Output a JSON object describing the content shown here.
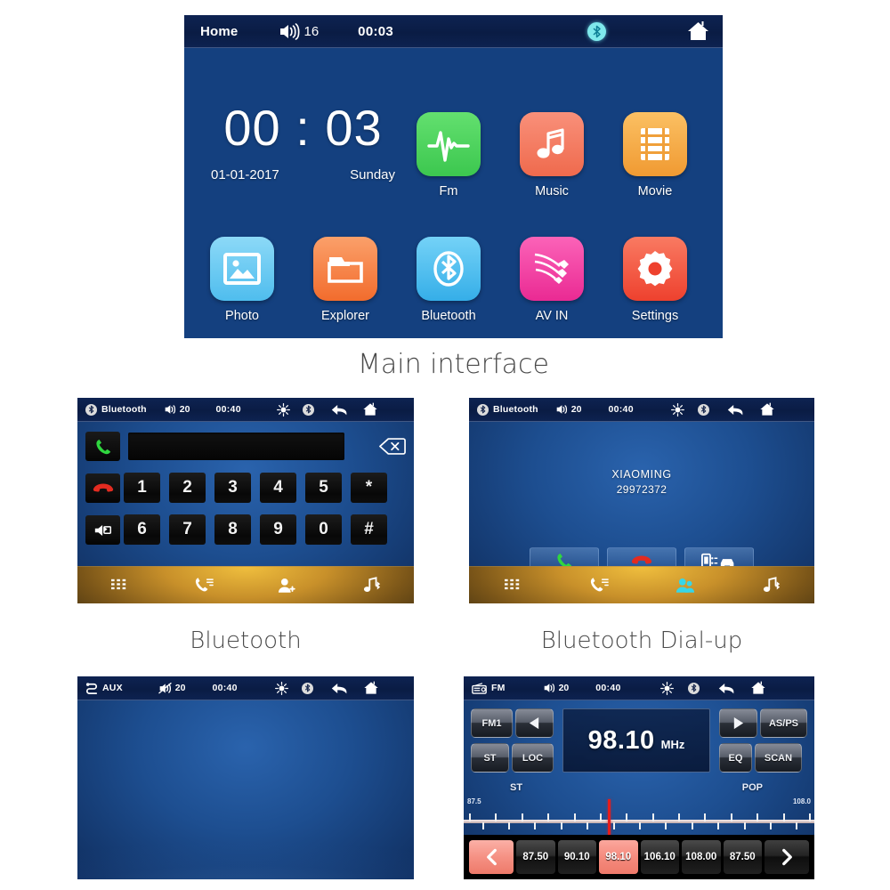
{
  "captions": {
    "main": "Main interface",
    "bluetooth": "Bluetooth",
    "dialup": "Bluetooth Dial-up"
  },
  "main_screen": {
    "statusbar": {
      "title": "Home",
      "volume": "16",
      "time": "00:03",
      "bluetooth_icon": "bluetooth-icon",
      "home_icon": "home-icon",
      "volume_icon": "volume-icon"
    },
    "clock": {
      "time": "00 : 03",
      "date": "01-01-2017",
      "weekday": "Sunday"
    },
    "apps_row1": [
      {
        "label": "Fm",
        "icon": "waveform-icon",
        "color": "#4cd25e"
      },
      {
        "label": "Music",
        "icon": "music-note-icon",
        "color": "#f4765c"
      },
      {
        "label": "Movie",
        "icon": "film-strip-icon",
        "color": "#f5a93f"
      }
    ],
    "apps_row2": [
      {
        "label": "Photo",
        "icon": "photo-icon",
        "color": "#61c8f2"
      },
      {
        "label": "Explorer",
        "icon": "folder-icon",
        "color": "#f4793c"
      },
      {
        "label": "Bluetooth",
        "icon": "bluetooth-icon",
        "color": "#49bdf0"
      },
      {
        "label": "AV IN",
        "icon": "av-cable-icon",
        "color": "#f23fa0"
      },
      {
        "label": "Settings",
        "icon": "gear-icon",
        "color": "#f0503c"
      }
    ]
  },
  "bluetooth_screen": {
    "statusbar": {
      "title": "Bluetooth",
      "volume": "20",
      "time": "00:40",
      "brightness_icon": "brightness-icon",
      "bluetooth_icon": "bluetooth-icon",
      "back_icon": "back-arrow-icon",
      "home_icon": "home-icon"
    },
    "number_input": "",
    "side_keys": [
      {
        "name": "call-answer-button",
        "icon": "green-handset-icon"
      },
      {
        "name": "call-end-button",
        "icon": "red-handset-icon"
      },
      {
        "name": "mute-toggle-button",
        "icon": "speaker-swap-icon"
      }
    ],
    "backspace": "backspace-icon",
    "keypad_row1": [
      "1",
      "2",
      "3",
      "4",
      "5",
      "*"
    ],
    "keypad_row2": [
      "6",
      "7",
      "8",
      "9",
      "0",
      "#"
    ],
    "navbar": [
      {
        "name": "nav-keypad",
        "icon": "keypad-icon",
        "active": false
      },
      {
        "name": "nav-calllog",
        "icon": "call-log-icon",
        "active": false
      },
      {
        "name": "nav-contacts",
        "icon": "contacts-icon",
        "active": false
      },
      {
        "name": "nav-music",
        "icon": "bt-music-icon",
        "active": false
      }
    ]
  },
  "dialup_screen": {
    "statusbar": {
      "title": "Bluetooth",
      "volume": "20",
      "time": "00:40"
    },
    "caller_name": "XIAOMING",
    "caller_number": "29972372",
    "call_buttons": [
      {
        "name": "answer-call-button",
        "icon": "green-handset-icon"
      },
      {
        "name": "hangup-call-button",
        "icon": "red-handset-icon"
      },
      {
        "name": "transfer-audio-button",
        "icon": "phone-to-car-icon"
      }
    ],
    "navbar": [
      {
        "name": "nav-keypad",
        "icon": "keypad-icon",
        "active": false
      },
      {
        "name": "nav-calllog",
        "icon": "call-log-icon",
        "active": false
      },
      {
        "name": "nav-contacts",
        "icon": "contacts-icon",
        "active": true
      },
      {
        "name": "nav-music",
        "icon": "bt-music-icon",
        "active": false
      }
    ]
  },
  "aux_screen": {
    "statusbar": {
      "title": "AUX",
      "volume": "20",
      "time": "00:40",
      "volume_icon": "volume-muted-icon",
      "source_icon": "aux-icon"
    }
  },
  "fm_screen": {
    "statusbar": {
      "title": "FM",
      "volume": "20",
      "time": "00:40",
      "source_icon": "radio-icon"
    },
    "left_buttons": [
      {
        "label": "FM1",
        "name": "fm-band-button"
      },
      {
        "label": "",
        "name": "tune-down-button",
        "icon": "left-triangle-icon"
      },
      {
        "label": "ST",
        "name": "stereo-button"
      },
      {
        "label": "LOC",
        "name": "local-button"
      }
    ],
    "frequency": "98.10",
    "unit": "MHz",
    "right_buttons": [
      {
        "label": "",
        "name": "tune-up-button",
        "icon": "right-triangle-icon"
      },
      {
        "label": "AS/PS",
        "name": "auto-store-button"
      },
      {
        "label": "EQ",
        "name": "eq-button"
      },
      {
        "label": "SCAN",
        "name": "scan-button"
      }
    ],
    "scale": {
      "st_label": "ST",
      "pop_label": "POP",
      "min": "87.5",
      "max": "108.0",
      "needle_percent": 41
    },
    "presets": [
      "87.50",
      "90.10",
      "98.10",
      "106.10",
      "108.00",
      "87.50"
    ],
    "active_preset_index": 2,
    "prev_icon": "chevron-left-icon",
    "next_icon": "chevron-right-icon"
  }
}
